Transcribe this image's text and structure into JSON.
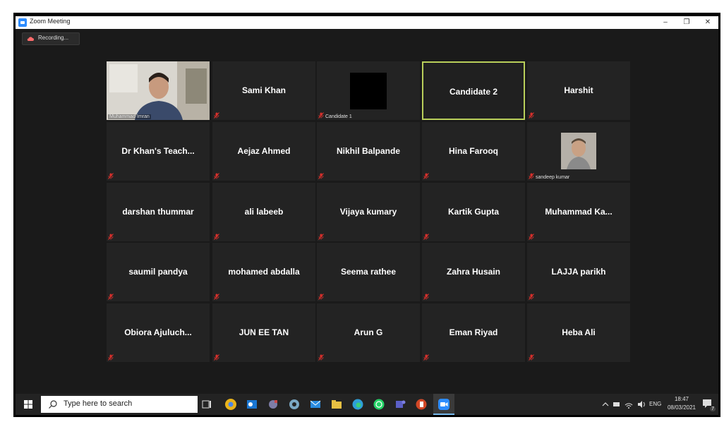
{
  "window": {
    "title": "Zoom Meeting",
    "minimize": "–",
    "restore": "❐",
    "close": "✕"
  },
  "recording": {
    "label": "Recording..."
  },
  "participants": [
    {
      "name": "",
      "label": "Muhammad Imran",
      "type": "video"
    },
    {
      "name": "Sami Khan",
      "type": "name"
    },
    {
      "name": "",
      "label": "Candidate 1",
      "type": "black"
    },
    {
      "name": "Candidate 2",
      "type": "name",
      "active": true
    },
    {
      "name": "Harshit",
      "type": "name"
    },
    {
      "name": "Dr Khan's Teach...",
      "type": "name"
    },
    {
      "name": "Aejaz Ahmed",
      "type": "name"
    },
    {
      "name": "Nikhil Balpande",
      "type": "name"
    },
    {
      "name": "Hina Farooq",
      "type": "name"
    },
    {
      "name": "",
      "label": "sandeep kumar",
      "type": "thumb"
    },
    {
      "name": "darshan thummar",
      "type": "name"
    },
    {
      "name": "ali labeeb",
      "type": "name"
    },
    {
      "name": "Vijaya kumary",
      "type": "name"
    },
    {
      "name": "Kartik Gupta",
      "type": "name"
    },
    {
      "name": "Muhammad Ka...",
      "type": "name"
    },
    {
      "name": "saumil pandya",
      "type": "name"
    },
    {
      "name": "mohamed abdalla",
      "type": "name"
    },
    {
      "name": "Seema rathee",
      "type": "name"
    },
    {
      "name": "Zahra Husain",
      "type": "name"
    },
    {
      "name": "LAJJA parikh",
      "type": "name"
    },
    {
      "name": "Obiora Ajuluch...",
      "type": "name"
    },
    {
      "name": "JUN EE TAN",
      "type": "name"
    },
    {
      "name": "Arun G",
      "type": "name"
    },
    {
      "name": "Eman Riyad",
      "type": "name"
    },
    {
      "name": "Heba Ali",
      "type": "name"
    }
  ],
  "taskbar": {
    "search_placeholder": "Type here to search",
    "language": "ENG",
    "time": "18:47",
    "date": "08/03/2021",
    "notification_count": "7"
  },
  "colors": {
    "active_border": "#b9cf5a",
    "muted_mic": "#d9302c",
    "tile_bg": "#232323"
  }
}
